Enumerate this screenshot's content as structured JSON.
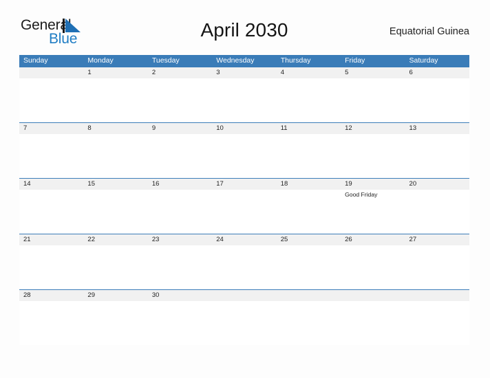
{
  "brand": {
    "name_part1": "General",
    "name_part2": "Blue",
    "mark": "blue-triangle-logo-mark",
    "accent_color": "#1f7dc4"
  },
  "header": {
    "title": "April 2030",
    "country": "Equatorial Guinea"
  },
  "theme": {
    "header_blue": "#3a7cb8",
    "date_strip_gray": "#f1f1f1",
    "page_background": "#fdfdfd",
    "text_color": "#222222"
  },
  "calendar": {
    "weekday_headers": [
      "Sunday",
      "Monday",
      "Tuesday",
      "Wednesday",
      "Thursday",
      "Friday",
      "Saturday"
    ],
    "weeks": [
      [
        {
          "date": "",
          "events": []
        },
        {
          "date": "1",
          "events": []
        },
        {
          "date": "2",
          "events": []
        },
        {
          "date": "3",
          "events": []
        },
        {
          "date": "4",
          "events": []
        },
        {
          "date": "5",
          "events": []
        },
        {
          "date": "6",
          "events": []
        }
      ],
      [
        {
          "date": "7",
          "events": []
        },
        {
          "date": "8",
          "events": []
        },
        {
          "date": "9",
          "events": []
        },
        {
          "date": "10",
          "events": []
        },
        {
          "date": "11",
          "events": []
        },
        {
          "date": "12",
          "events": []
        },
        {
          "date": "13",
          "events": []
        }
      ],
      [
        {
          "date": "14",
          "events": []
        },
        {
          "date": "15",
          "events": []
        },
        {
          "date": "16",
          "events": []
        },
        {
          "date": "17",
          "events": []
        },
        {
          "date": "18",
          "events": []
        },
        {
          "date": "19",
          "events": [
            "Good Friday"
          ]
        },
        {
          "date": "20",
          "events": []
        }
      ],
      [
        {
          "date": "21",
          "events": []
        },
        {
          "date": "22",
          "events": []
        },
        {
          "date": "23",
          "events": []
        },
        {
          "date": "24",
          "events": []
        },
        {
          "date": "25",
          "events": []
        },
        {
          "date": "26",
          "events": []
        },
        {
          "date": "27",
          "events": []
        }
      ],
      [
        {
          "date": "28",
          "events": []
        },
        {
          "date": "29",
          "events": []
        },
        {
          "date": "30",
          "events": []
        },
        {
          "date": "",
          "events": []
        },
        {
          "date": "",
          "events": []
        },
        {
          "date": "",
          "events": []
        },
        {
          "date": "",
          "events": []
        }
      ]
    ]
  }
}
